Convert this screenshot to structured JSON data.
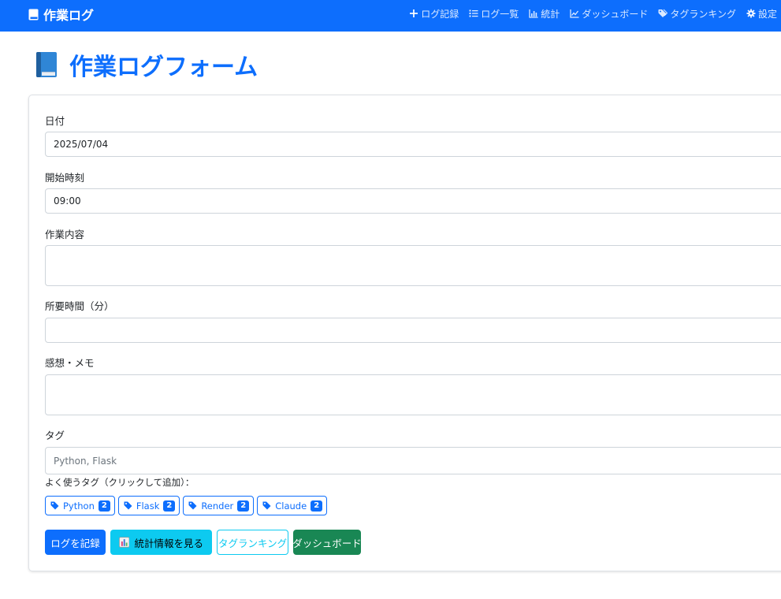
{
  "navbar": {
    "brand": "作業ログ",
    "brand_icon": "book-icon",
    "items": [
      {
        "label": "ログ記録",
        "icon": "plus-icon"
      },
      {
        "label": "ログ一覧",
        "icon": "list-icon"
      },
      {
        "label": "統計",
        "icon": "bar-chart-icon"
      },
      {
        "label": "ダッシュボード",
        "icon": "line-chart-icon"
      },
      {
        "label": "タグランキング",
        "icon": "tags-icon"
      },
      {
        "label": "設定",
        "icon": "gear-icon"
      }
    ],
    "background": "#0d6efd"
  },
  "page": {
    "title": "作業ログフォーム",
    "title_icon": "blue-book-icon"
  },
  "form": {
    "date": {
      "label": "日付",
      "value": "2025/07/04"
    },
    "start_time": {
      "label": "開始時刻",
      "value": "09:00"
    },
    "content": {
      "label": "作業内容",
      "value": ""
    },
    "duration": {
      "label": "所要時間（分）",
      "value": ""
    },
    "memo": {
      "label": "感想・メモ",
      "value": ""
    },
    "tags": {
      "label": "タグ",
      "value": "",
      "placeholder": "Python, Flask"
    },
    "frequent_tags_hint": "よく使うタグ（クリックして追加）："
  },
  "frequent_tags": [
    {
      "name": "Python",
      "count": "2"
    },
    {
      "name": "Flask",
      "count": "2"
    },
    {
      "name": "Render",
      "count": "2"
    },
    {
      "name": "Claude",
      "count": "2"
    }
  ],
  "buttons": {
    "submit": "ログを記録",
    "stats": "統計情報を見る",
    "tag_ranking": "タグランキング",
    "dashboard": "ダッシュボード"
  },
  "colors": {
    "primary": "#0d6efd",
    "info": "#0dcaf0",
    "success": "#198754"
  }
}
